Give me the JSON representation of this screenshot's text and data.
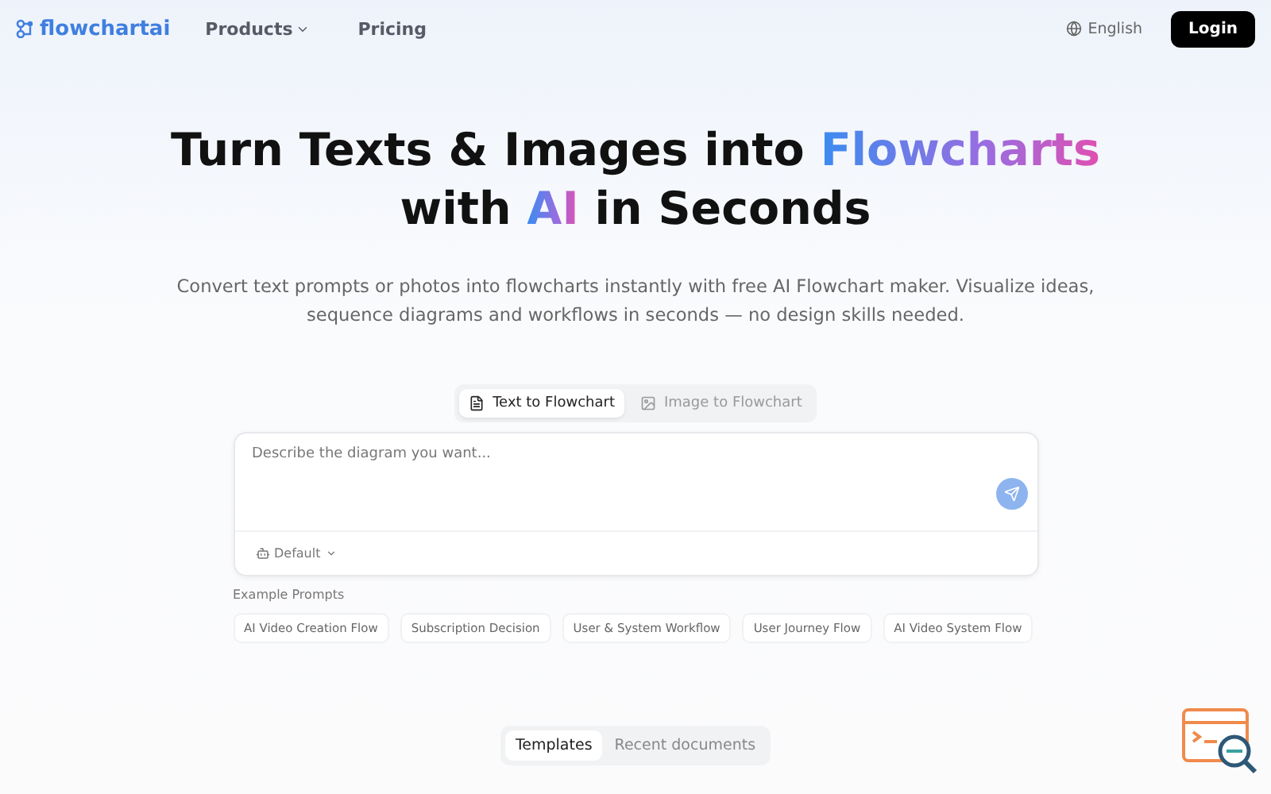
{
  "nav": {
    "logo": "flowchartai",
    "links": [
      {
        "label": "Products",
        "dropdown": true
      },
      {
        "label": "Pricing",
        "dropdown": false
      }
    ],
    "language": "English",
    "login": "Login"
  },
  "hero": {
    "title_lines": [
      [
        {
          "text": "Turn Texts & Images into ",
          "highlight": false
        },
        {
          "text": "Flowcharts",
          "highlight": true
        }
      ],
      [
        {
          "text": "with ",
          "highlight": false
        },
        {
          "text": "AI",
          "highlight": true
        },
        {
          "text": " in Seconds",
          "highlight": false
        }
      ]
    ],
    "subtitle": "Convert text prompts or photos into flowcharts instantly with free AI Flowchart maker. Visualize ideas, sequence diagrams and workflows in seconds — no design skills needed."
  },
  "mode_tabs": [
    {
      "label": "Text to Flowchart",
      "kind": "text",
      "selected": true
    },
    {
      "label": "Image to Flowchart",
      "kind": "image",
      "selected": false
    }
  ],
  "prompt": {
    "placeholder": "Describe the diagram you want...",
    "model": "Default"
  },
  "examples": {
    "label": "Example Prompts",
    "items": [
      "AI Video Creation Flow",
      "Subscription Decision",
      "User & System Workflow",
      "User Journey Flow",
      "AI Video System Flow"
    ]
  },
  "bottom_tabs": [
    {
      "label": "Templates",
      "selected": true
    },
    {
      "label": "Recent documents",
      "selected": false
    }
  ]
}
